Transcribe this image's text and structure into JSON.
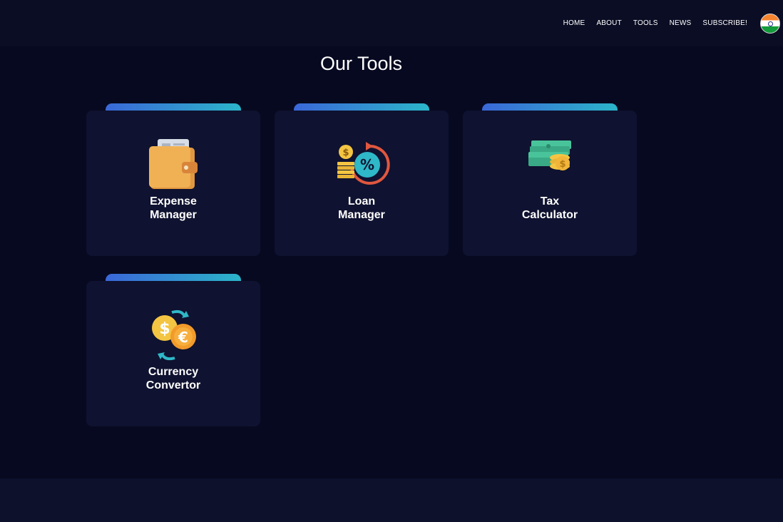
{
  "nav": {
    "items": [
      {
        "label": "HOME"
      },
      {
        "label": "ABOUT"
      },
      {
        "label": "TOOLS"
      },
      {
        "label": "NEWS"
      },
      {
        "label": "SUBSCRIBE!"
      }
    ],
    "flag_icon": "india-flag-icon"
  },
  "main": {
    "title": "Our Tools",
    "tools": [
      {
        "line1": "Expense",
        "line2": "Manager",
        "icon": "wallet-icon"
      },
      {
        "line1": "Loan",
        "line2": "Manager",
        "icon": "loan-percent-icon"
      },
      {
        "line1": "Tax",
        "line2": "Calculator",
        "icon": "money-stack-icon"
      },
      {
        "line1": "Currency",
        "line2": "Convertor",
        "icon": "currency-exchange-icon"
      }
    ]
  },
  "colors": {
    "background": "#070920",
    "card": "#0f1230",
    "tab_gradient_start": "#3a67d8",
    "tab_gradient_end": "#2bb5c9"
  }
}
